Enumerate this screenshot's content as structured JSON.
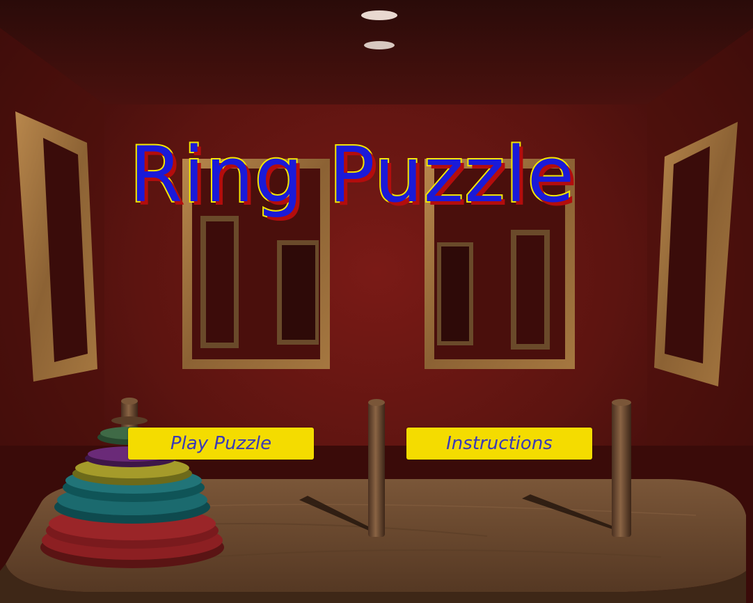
{
  "game": {
    "title": "Ring Puzzle",
    "buttons": {
      "play_label": "Play Puzzle",
      "instructions_label": "Instructions"
    }
  },
  "colors": {
    "title_fill": "#1a1ad8",
    "title_outline": "#f2e600",
    "title_shadow": "#b30d0d",
    "button_bg": "#f4dc00",
    "button_text": "#3a3ab8",
    "wall": "#6a1612",
    "table": "#6b4a32"
  },
  "scene": {
    "pegs": 3,
    "rings_on_left_peg": [
      "red",
      "red",
      "teal",
      "teal",
      "yellow",
      "purple",
      "green"
    ]
  }
}
